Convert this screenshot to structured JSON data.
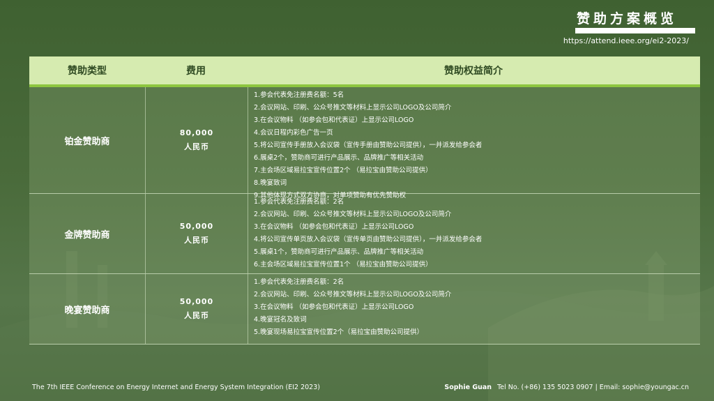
{
  "header": {
    "title": "赞助方案概览",
    "url": "https://attend.ieee.org/ei2-2023/"
  },
  "table": {
    "headers": [
      "赞助类型",
      "费用",
      "赞助权益简介"
    ],
    "rows": [
      {
        "type": "铂金赞助商",
        "fee_amount": "80,000",
        "fee_currency": "人民币",
        "benefits": [
          "1.参会代表免注册费名额：5名",
          "2.会议网站、印刷、公众号推文等材料上显示公司LOGO及公司简介",
          "3.在会议物料 （如参会包和代表证）上显示公司LOGO",
          "4.会议日程内彩色广告一页",
          "5.将公司宣传手册放入会议袋（宣传手册由赞助公司提供），一并派发给参会者",
          "6.展桌2个，赞助商可进行产品展示、品牌推广等相关活动",
          "7.主会场区域易拉宝宣传位置2个 （易拉宝由赞助公司提供）",
          "8.晚宴致词",
          "9.其他体现方式双方协商，对单项赞助有优先赞助权"
        ]
      },
      {
        "type": "金牌赞助商",
        "fee_amount": "50,000",
        "fee_currency": "人民币",
        "benefits": [
          "1.参会代表免注册费名额：2名",
          "2.会议网站、印刷、公众号推文等材料上显示公司LOGO及公司简介",
          "3.在会议物料 （如参会包和代表证）上显示公司LOGO",
          "4.将公司宣传单页放入会议袋（宣传单页由赞助公司提供），一并派发给参会者",
          "5.展桌1个，赞助商可进行产品展示、品牌推广等相关活动",
          "6.主会场区域易拉宝宣传位置1个 （易拉宝由赞助公司提供）"
        ]
      },
      {
        "type": "晚宴赞助商",
        "fee_amount": "50,000",
        "fee_currency": "人民币",
        "benefits": [
          "1.参会代表免注册费名额：2名",
          "2.会议网站、印刷、公众号推文等材料上显示公司LOGO及公司简介",
          "3.在会议物料 （如参会包和代表证）上显示公司LOGO",
          "4.晚宴冠名及致词",
          "5.晚宴现场易拉宝宣传位置2个（易拉宝由赞助公司提供）"
        ]
      }
    ]
  },
  "footer": {
    "conference": "The 7th IEEE Conference on Energy Internet and Energy System Integration (EI2 2023)",
    "contact_name": "Sophie Guan",
    "contact_info": "Tel No. (+86) 135 5023 0907 | Email: sophie@youngac.cn"
  }
}
